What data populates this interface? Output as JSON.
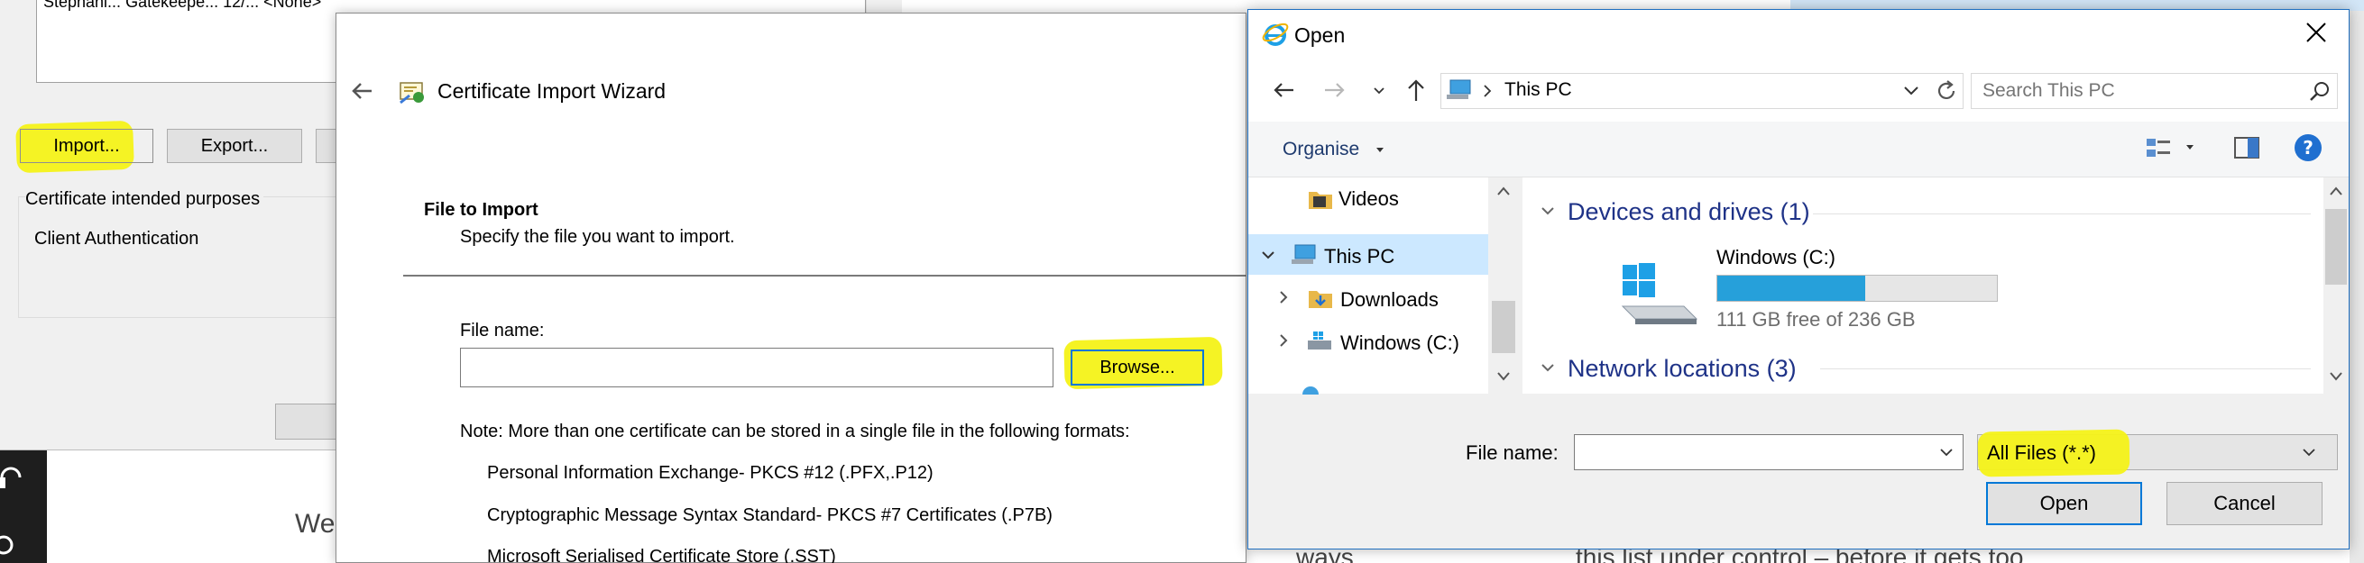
{
  "cert_manager": {
    "row_text": "Stephani...   Gatekeepe...   12/...   <None>",
    "import_label": "Import...",
    "export_label": "Export...",
    "purposes_label": "Certificate intended purposes",
    "purpose_value": "Client Authentication"
  },
  "background_page": {
    "text_left": "We",
    "text_ways": "ways",
    "text_right": "this list under control – before it gets too"
  },
  "wizard": {
    "title": "Certificate Import Wizard",
    "heading": "File to Import",
    "subheading": "Specify the file you want to import.",
    "file_name_label": "File name:",
    "file_name_value": "",
    "browse_label": "Browse...",
    "note": "Note:  More than one certificate can be stored in a single file in the following formats:",
    "formats": [
      "Personal Information Exchange- PKCS #12 (.PFX,.P12)",
      "Cryptographic Message Syntax Standard- PKCS #7 Certificates (.P7B)",
      "Microsoft Serialised Certificate Store (.SST)"
    ]
  },
  "open_dialog": {
    "title": "Open",
    "address": "This PC",
    "search_placeholder": "Search This PC",
    "organise_label": "Organise",
    "tree": {
      "videos": "Videos",
      "this_pc": "This PC",
      "downloads": "Downloads",
      "windows_c": "Windows (C:)"
    },
    "devices_header": "Devices and drives (1)",
    "drive_name": "Windows (C:)",
    "drive_free": "111 GB free of 236 GB",
    "drive_used_fraction": 0.53,
    "network_header": "Network locations (3)",
    "file_name_label": "File name:",
    "file_name_value": "",
    "filter_value": "All Files (*.*)",
    "open_label": "Open",
    "cancel_label": "Cancel"
  }
}
